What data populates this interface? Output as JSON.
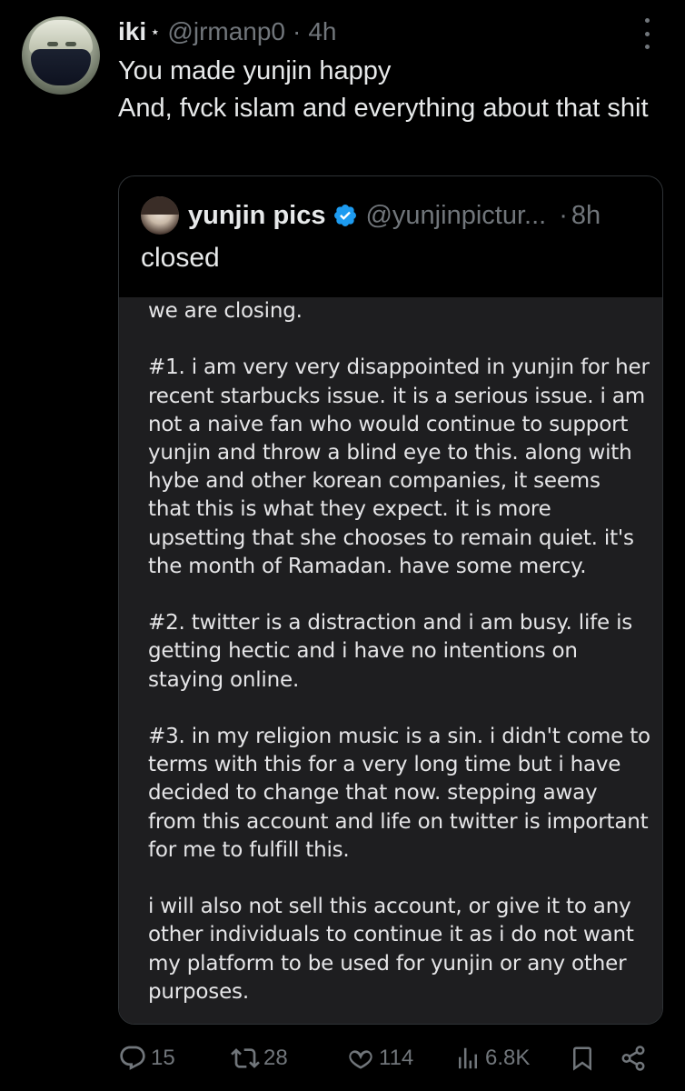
{
  "author": {
    "display_name": "iki",
    "badge": "⋆",
    "handle": "@jrmanp0",
    "time": "4h"
  },
  "tweet": {
    "lines": [
      "You made yunjin happy",
      "And, fvck islam and everything about that shit"
    ]
  },
  "quote": {
    "display_name": "yunjin pics",
    "handle": "@yunjinpictur...",
    "time": "8h",
    "verified": true,
    "text": "closed",
    "image_text": {
      "p0": "we are closing.",
      "p1": "#1. i am very very disappointed in yunjin for her\nrecent starbucks issue. it is a serious issue. i am\nnot a naive fan who would continue to support\nyunjin and throw a blind eye to this. along with\nhybe and other korean companies, it seems\nthat this is what they expect. it is more\nupsetting that she chooses to remain quiet. it's\nthe month of Ramadan. have some mercy.",
      "p2": "#2. twitter is a distraction and i am busy. life is\ngetting hectic and i have no intentions on\nstaying online.",
      "p3": "#3. in my religion music is a sin. i didn't come to\nterms with this for a very long time but i have\ndecided to change that now. stepping away\nfrom this account and life on twitter is important\nfor me to fulfill this.",
      "p4": "i will also not sell this account, or give it to any\nother individuals to continue it as i do not want\nmy platform to be used for yunjin or any other\npurposes."
    }
  },
  "actions": {
    "replies": "15",
    "reposts": "28",
    "likes": "114",
    "views": "6.8K"
  },
  "icons": {
    "reply": "reply-icon",
    "repost": "repost-icon",
    "like": "heart-icon",
    "views": "views-icon",
    "bookmark": "bookmark-icon",
    "share": "share-icon",
    "more": "more-icon",
    "verified": "verified-badge-icon"
  },
  "colors": {
    "background": "#000000",
    "text": "#e7e9ea",
    "secondary": "#71767b",
    "verified": "#1d9bf0",
    "border": "#2f3336"
  }
}
